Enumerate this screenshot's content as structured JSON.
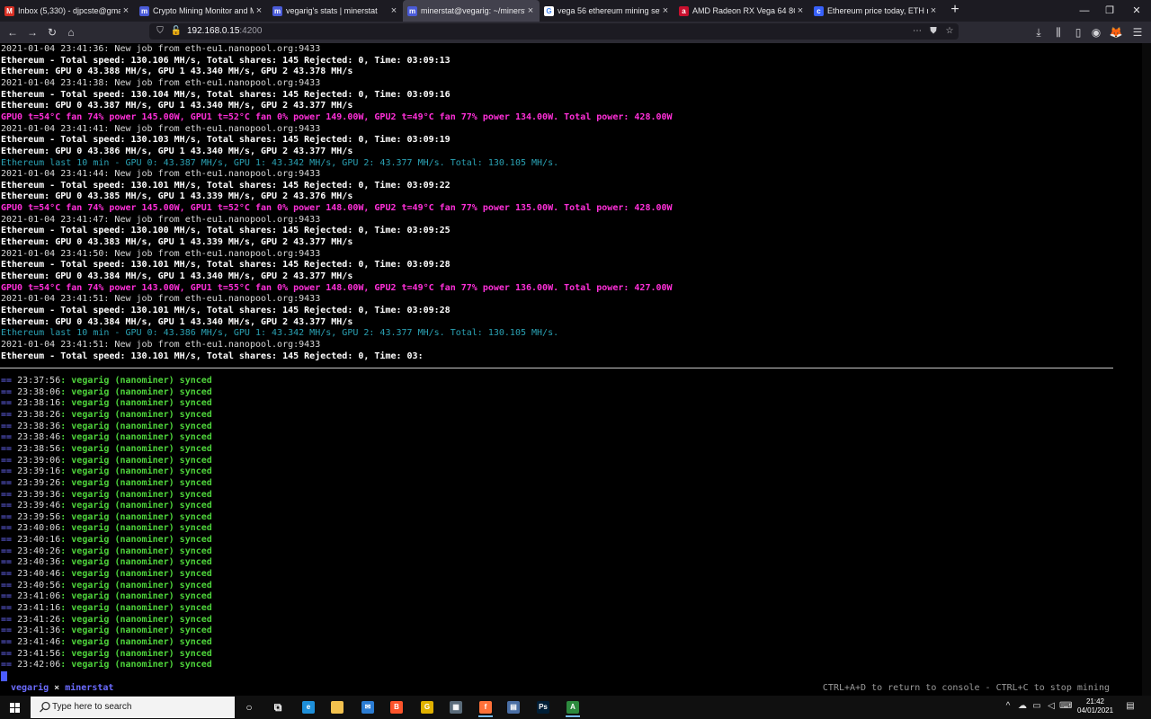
{
  "browser": {
    "tabs": [
      {
        "title": "Inbox (5,330) - djpcste@gmail.",
        "favicon": "gmail-icon",
        "color": "#d93025",
        "glyph": "M"
      },
      {
        "title": "Crypto Mining Monitor and M",
        "favicon": "minerstat-icon",
        "color": "#4a5bd8",
        "glyph": "m"
      },
      {
        "title": "vegarig's stats | minerstat",
        "favicon": "minerstat-icon",
        "color": "#4a5bd8",
        "glyph": "m"
      },
      {
        "title": "minerstat@vegarig: ~/minerst",
        "favicon": "minerstat-icon",
        "color": "#4a5bd8",
        "glyph": "m",
        "active": true
      },
      {
        "title": "vega 56 ethereum mining setti",
        "favicon": "google-icon",
        "color": "#ffffff",
        "glyph": "G"
      },
      {
        "title": "AMD Radeon RX Vega 64 8GB H",
        "favicon": "amd-icon",
        "color": "#c8102e",
        "glyph": "a"
      },
      {
        "title": "Ethereum price today, ETH ma",
        "favicon": "coinmarketcap-icon",
        "color": "#3861fb",
        "glyph": "c"
      }
    ],
    "new_tab_label": "+",
    "url_host": "192.168.0.15",
    "url_port": ":4200"
  },
  "terminal": {
    "log_lines": [
      {
        "c": "white",
        "t": "2021-01-04 23:41:36: New job from eth-eu1.nanopool.org:9433"
      },
      {
        "c": "bold",
        "t": "Ethereum - Total speed: 130.106 MH/s, Total shares: 145 Rejected: 0, Time: 03:09:13"
      },
      {
        "c": "bold",
        "t": "Ethereum: GPU 0 43.388 MH/s, GPU 1 43.340 MH/s, GPU 2 43.378 MH/s"
      },
      {
        "c": "white",
        "t": "2021-01-04 23:41:38: New job from eth-eu1.nanopool.org:9433"
      },
      {
        "c": "bold",
        "t": "Ethereum - Total speed: 130.104 MH/s, Total shares: 145 Rejected: 0, Time: 03:09:16"
      },
      {
        "c": "bold",
        "t": "Ethereum: GPU 0 43.387 MH/s, GPU 1 43.340 MH/s, GPU 2 43.377 MH/s"
      },
      {
        "c": "mag",
        "t": "GPU0 t=54°C fan 74% power 145.00W, GPU1 t=52°C fan 0% power 149.00W, GPU2 t=49°C fan 77% power 134.00W. Total power: 428.00W"
      },
      {
        "c": "white",
        "t": "2021-01-04 23:41:41: New job from eth-eu1.nanopool.org:9433"
      },
      {
        "c": "bold",
        "t": "Ethereum - Total speed: 130.103 MH/s, Total shares: 145 Rejected: 0, Time: 03:09:19"
      },
      {
        "c": "bold",
        "t": "Ethereum: GPU 0 43.386 MH/s, GPU 1 43.340 MH/s, GPU 2 43.377 MH/s"
      },
      {
        "c": "cyan",
        "t": "Ethereum last 10 min - GPU 0: 43.387 MH/s, GPU 1: 43.342 MH/s, GPU 2: 43.377 MH/s. Total: 130.105 MH/s."
      },
      {
        "c": "white",
        "t": "2021-01-04 23:41:44: New job from eth-eu1.nanopool.org:9433"
      },
      {
        "c": "bold",
        "t": "Ethereum - Total speed: 130.101 MH/s, Total shares: 145 Rejected: 0, Time: 03:09:22"
      },
      {
        "c": "bold",
        "t": "Ethereum: GPU 0 43.385 MH/s, GPU 1 43.339 MH/s, GPU 2 43.376 MH/s"
      },
      {
        "c": "mag",
        "t": "GPU0 t=54°C fan 74% power 145.00W, GPU1 t=52°C fan 0% power 148.00W, GPU2 t=49°C fan 77% power 135.00W. Total power: 428.00W"
      },
      {
        "c": "white",
        "t": "2021-01-04 23:41:47: New job from eth-eu1.nanopool.org:9433"
      },
      {
        "c": "bold",
        "t": "Ethereum - Total speed: 130.100 MH/s, Total shares: 145 Rejected: 0, Time: 03:09:25"
      },
      {
        "c": "bold",
        "t": "Ethereum: GPU 0 43.383 MH/s, GPU 1 43.339 MH/s, GPU 2 43.377 MH/s"
      },
      {
        "c": "white",
        "t": "2021-01-04 23:41:50: New job from eth-eu1.nanopool.org:9433"
      },
      {
        "c": "bold",
        "t": "Ethereum - Total speed: 130.101 MH/s, Total shares: 145 Rejected: 0, Time: 03:09:28"
      },
      {
        "c": "bold",
        "t": "Ethereum: GPU 0 43.384 MH/s, GPU 1 43.340 MH/s, GPU 2 43.377 MH/s"
      },
      {
        "c": "mag",
        "t": "GPU0 t=54°C fan 74% power 143.00W, GPU1 t=55°C fan 0% power 148.00W, GPU2 t=49°C fan 77% power 136.00W. Total power: 427.00W"
      },
      {
        "c": "white",
        "t": "2021-01-04 23:41:51: New job from eth-eu1.nanopool.org:9433"
      },
      {
        "c": "bold",
        "t": "Ethereum - Total speed: 130.101 MH/s, Total shares: 145 Rejected: 0, Time: 03:09:28"
      },
      {
        "c": "bold",
        "t": "Ethereum: GPU 0 43.384 MH/s, GPU 1 43.340 MH/s, GPU 2 43.377 MH/s"
      },
      {
        "c": "cyan",
        "t": "Ethereum last 10 min - GPU 0: 43.386 MH/s, GPU 1: 43.342 MH/s, GPU 2: 43.377 MH/s. Total: 130.105 MH/s."
      },
      {
        "c": "white",
        "t": "2021-01-04 23:41:51: New job from eth-eu1.nanopool.org:9433"
      },
      {
        "c": "bold",
        "t": "Ethereum - Total speed: 130.101 MH/s, Total shares: 145 Rejected: 0, Time: 03:"
      }
    ],
    "sync_prefix": "== ",
    "sync_suffix": ": vegarig (nanominer) synced",
    "sync_times": [
      "23:37:56",
      "23:38:06",
      "23:38:16",
      "23:38:26",
      "23:38:36",
      "23:38:46",
      "23:38:56",
      "23:39:06",
      "23:39:16",
      "23:39:26",
      "23:39:36",
      "23:39:46",
      "23:39:56",
      "23:40:06",
      "23:40:16",
      "23:40:26",
      "23:40:36",
      "23:40:46",
      "23:40:56",
      "23:41:06",
      "23:41:16",
      "23:41:26",
      "23:41:36",
      "23:41:46",
      "23:41:56",
      "23:42:06"
    ],
    "status_rig": "vegarig",
    "status_sep": " × ",
    "status_app": "minerstat",
    "status_hint": "CTRL+A+D to return to console - CTRL+C to stop mining"
  },
  "taskbar": {
    "search_placeholder": "Type here to search",
    "apps": [
      {
        "name": "cortana-icon",
        "color": "#101010",
        "glyph": "○"
      },
      {
        "name": "task-view-icon",
        "color": "#101010",
        "glyph": "⧉"
      },
      {
        "name": "edge-icon",
        "color": "#1e8fd9",
        "glyph": "e"
      },
      {
        "name": "file-explorer-icon",
        "color": "#f2c14e",
        "glyph": ""
      },
      {
        "name": "mail-icon",
        "color": "#2b7cd3",
        "glyph": "✉"
      },
      {
        "name": "brave-icon",
        "color": "#fb542b",
        "glyph": "B"
      },
      {
        "name": "geforce-icon",
        "color": "#e0b100",
        "glyph": "G"
      },
      {
        "name": "calculator-icon",
        "color": "#5a6b7a",
        "glyph": "▦"
      },
      {
        "name": "firefox-icon",
        "color": "#ff7139",
        "glyph": "f",
        "running": true
      },
      {
        "name": "pc-manager-icon",
        "color": "#4a6fa5",
        "glyph": "▤"
      },
      {
        "name": "photoshop-icon",
        "color": "#001e36",
        "glyph": "Ps"
      },
      {
        "name": "app-a-icon",
        "color": "#2d8a3e",
        "glyph": "A",
        "running": true
      }
    ],
    "time": "21:42",
    "date": "04/01/2021"
  }
}
